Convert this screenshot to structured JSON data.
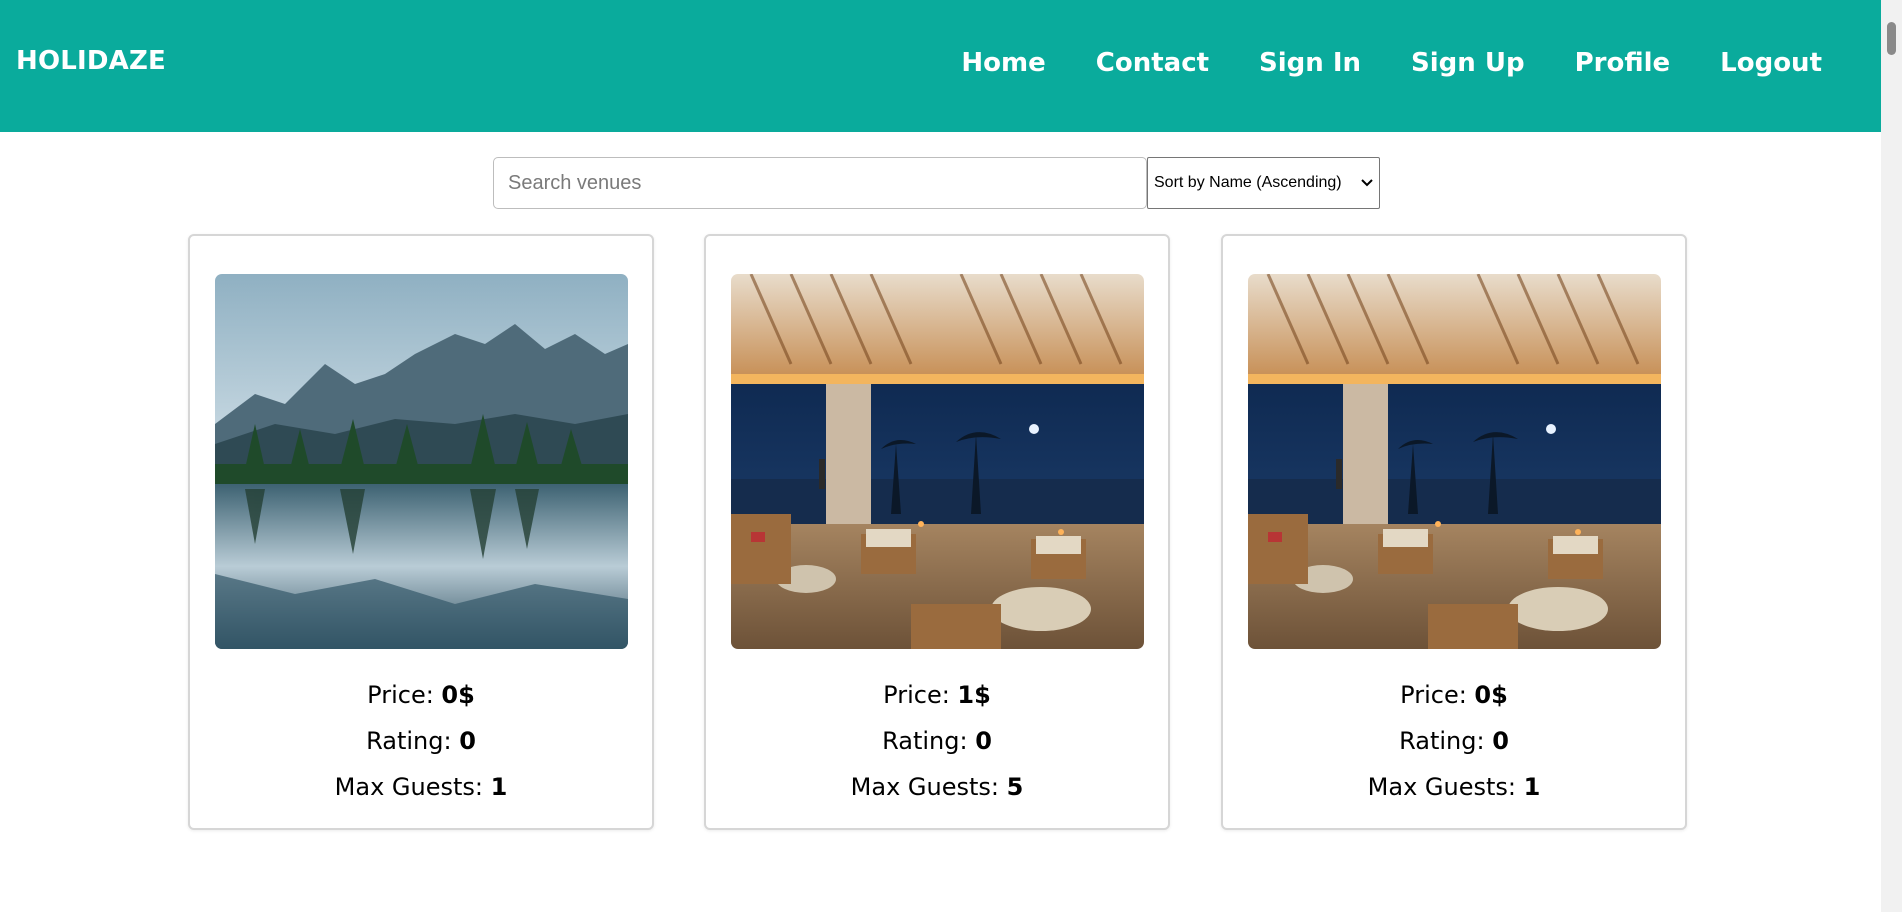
{
  "brand": "HOLIDAZE",
  "nav": [
    "Home",
    "Contact",
    "Sign In",
    "Sign Up",
    "Profile",
    "Logout"
  ],
  "search": {
    "placeholder": "Search venues",
    "value": ""
  },
  "sort": {
    "selected": "Sort by Name (Ascending)"
  },
  "labels": {
    "price": "Price:",
    "rating": "Rating:",
    "max_guests": "Max Guests:"
  },
  "venues": [
    {
      "image": "mountain-lake-photo",
      "price": "0$",
      "rating": "0",
      "max_guests": "1"
    },
    {
      "image": "night-lounge-photo",
      "price": "1$",
      "rating": "0",
      "max_guests": "5"
    },
    {
      "image": "night-lounge-photo",
      "price": "0$",
      "rating": "0",
      "max_guests": "1"
    }
  ],
  "colors": {
    "header": "#0aab9c",
    "header_text": "#ffffff"
  }
}
